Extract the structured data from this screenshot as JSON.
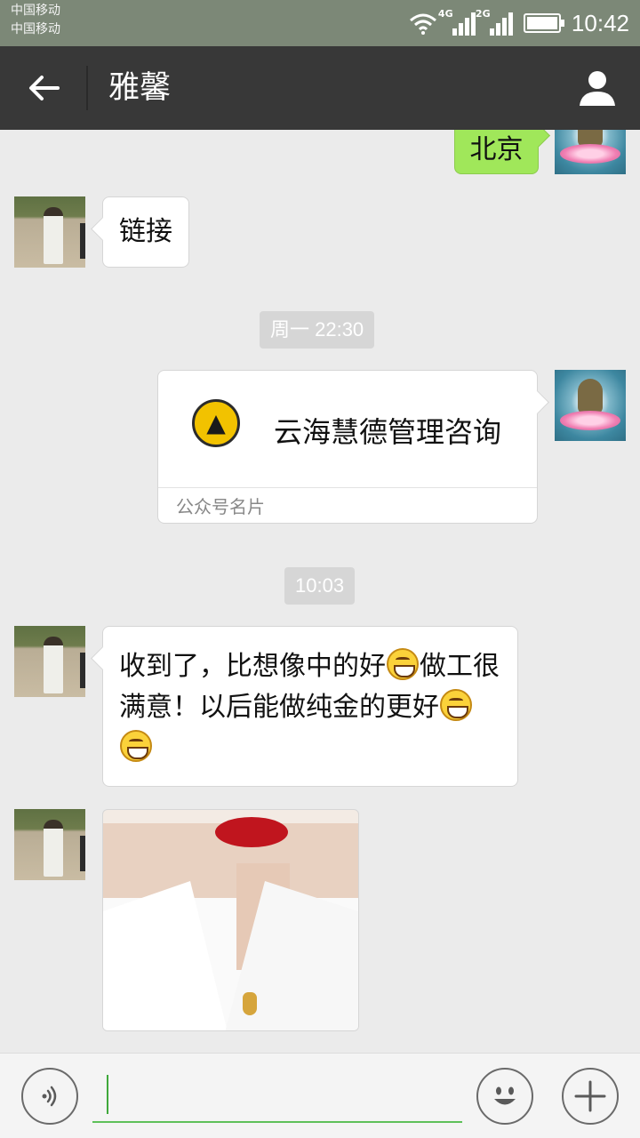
{
  "status_bar": {
    "carrier_1": "中国移动",
    "carrier_2": "中国移动",
    "network_1": "4G",
    "network_2": "2G",
    "time": "10:42"
  },
  "nav": {
    "title": "雅馨",
    "icons": {
      "back": "arrow-left-icon",
      "profile": "person-icon"
    }
  },
  "messages": {
    "msg_beijing": "北京",
    "msg_link": "链接",
    "timestamp_1": "周一 22:30",
    "card": {
      "name": "云海慧德管理咨询",
      "type_label": "公众号名片"
    },
    "timestamp_2": "10:03",
    "msg_feedback": {
      "part1": "收到了，比想像中的好",
      "part2": "做工很满意！以后能做纯金的更好"
    }
  },
  "input_bar": {
    "value": "",
    "icons": {
      "voice": "voice-icon",
      "emoji": "smiley-icon",
      "more": "plus-icon"
    }
  },
  "colors": {
    "status_bar": "#7c8877",
    "nav_bar": "#383838",
    "chat_bg": "#ebebeb",
    "own_bubble": "#a0e75a",
    "input_underline": "#5ec15a"
  }
}
